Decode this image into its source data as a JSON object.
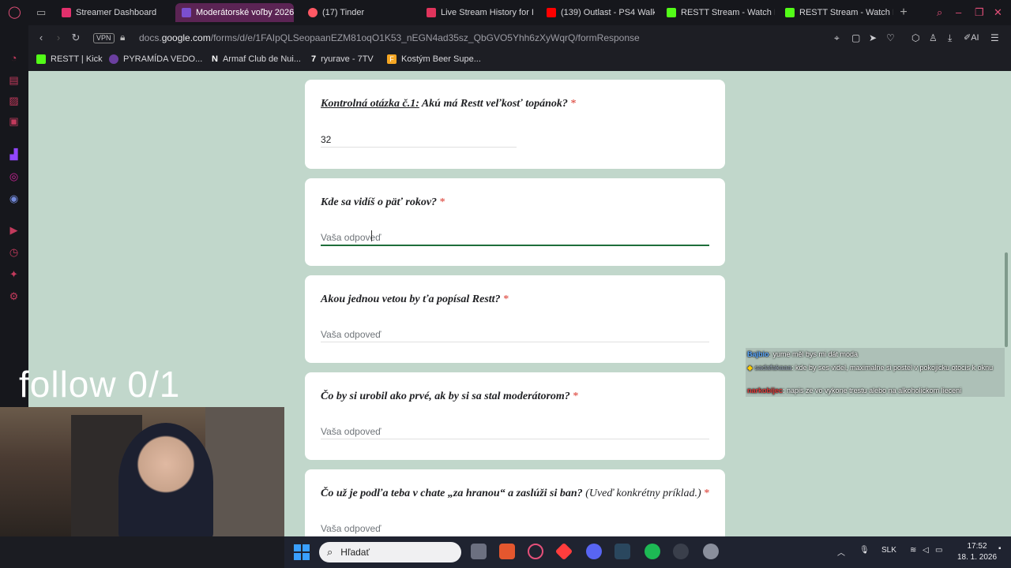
{
  "browser": {
    "tabs": [
      {
        "label": "Streamer Dashboard",
        "color": "#e1306c",
        "active": false
      },
      {
        "label": "Moderátorské voľby 2026",
        "color": "#7b4fcf",
        "active": true
      },
      {
        "label": "(17) Tinder",
        "color": "#ff5864",
        "active": false
      },
      {
        "label": "Live Stream History for I",
        "color": "#e0345c",
        "active": false
      },
      {
        "label": "(139) Outlast - PS4 Walk",
        "color": "#ff0000",
        "active": false
      },
      {
        "label": "RESTT Stream - Watch L",
        "color": "#53fc18",
        "active": false
      },
      {
        "label": "RESTT Stream - Watch L",
        "color": "#53fc18",
        "active": false
      }
    ],
    "url_prefix": "docs.",
    "url_domain": "google.com",
    "url_path": "/forms/d/e/1FAIpQLSeopaanEZM81oqO1K53_nEGN4ad35sz_QbGVO5Yhh6zXyWqrQ/formResponse",
    "vpn_label": "VPN",
    "ai_label": "AI",
    "bookmarks": [
      {
        "label": "RESTT | Kick",
        "color": "#53fc18"
      },
      {
        "label": "PYRAMÍDA VEDO...",
        "color": "#6b3fa0"
      },
      {
        "label": "Armaf Club de Nui...",
        "color": "#222222"
      },
      {
        "label": "ryurave - 7TV",
        "color": "#222222"
      },
      {
        "label": "Kostým Beer Supe...",
        "color": "#f5a623"
      }
    ]
  },
  "form": {
    "questions": [
      {
        "prefix": "Kontrolná otázka č.1:",
        "text": " Akú má Restt veľkosť topánok?",
        "note": "",
        "answer": "32",
        "filled": true,
        "focused": false
      },
      {
        "prefix": "",
        "text": "Kde sa vidíš o päť rokov?",
        "note": "",
        "answer": "Vaša odpoveď",
        "filled": false,
        "focused": true
      },
      {
        "prefix": "",
        "text": "Akou jednou vetou by ťa popísal Restt?",
        "note": "",
        "answer": "Vaša odpoveď",
        "filled": false,
        "focused": false
      },
      {
        "prefix": "",
        "text": "Čo by si urobil ako prvé, ak by si sa stal moderátorom?",
        "note": "",
        "answer": "Vaša odpoveď",
        "filled": false,
        "focused": false
      },
      {
        "prefix": "",
        "text": "Čo už je podľa teba v chate „za hranou“ a zaslúži si ban?",
        "note": " (Uveď konkrétny príklad.)",
        "answer": "Vaša odpoveď",
        "filled": false,
        "focused": false
      }
    ],
    "required_mark": "*"
  },
  "overlay": {
    "follow_text": "follow 0/1",
    "chat": [
      {
        "user": "Bajbio",
        "text": ": yume měl bys mi dát moda"
      },
      {
        "user": "sadafakaaa",
        "text": ": kde by ses videl, maximalne si postel v pokojicku otocis k oknu"
      },
      {
        "user": "narkobijec",
        "text": ": napis ze vo vykone trestu alebo na alkoholickom lieceni"
      }
    ]
  },
  "taskbar": {
    "search_placeholder": "Hľadať",
    "language": "SLK",
    "time": "17:52",
    "date": "18. 1. 2026"
  }
}
